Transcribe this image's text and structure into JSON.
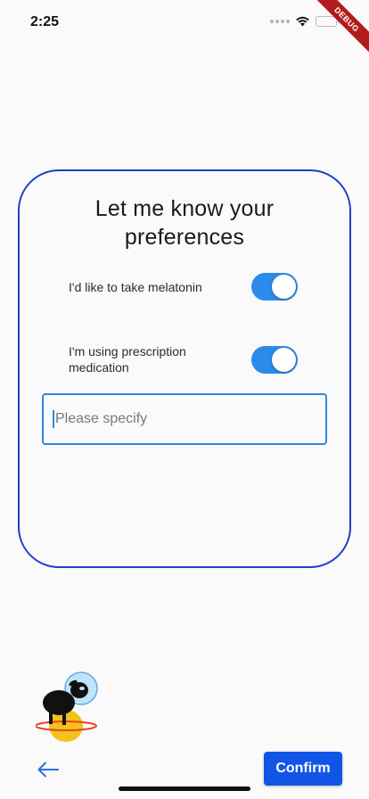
{
  "status_bar": {
    "time": "2:25",
    "icons": [
      "signal-dots",
      "wifi-icon",
      "battery-icon"
    ],
    "debug_label": "DEBUG"
  },
  "card": {
    "title": "Let me know your preferences",
    "border_color": "#1f3fc8",
    "preferences": [
      {
        "label": "I'd like to take melatonin",
        "enabled": true
      },
      {
        "label": "I'm using prescription medication",
        "enabled": true
      }
    ],
    "specify_field": {
      "value": "",
      "placeholder": "Please specify"
    }
  },
  "footer": {
    "back_icon": "arrow-left-icon",
    "confirm_label": "Confirm"
  },
  "colors": {
    "accent": "#2c8ae8",
    "primary_button": "#1255e6",
    "debug_banner": "#b31b1b"
  }
}
